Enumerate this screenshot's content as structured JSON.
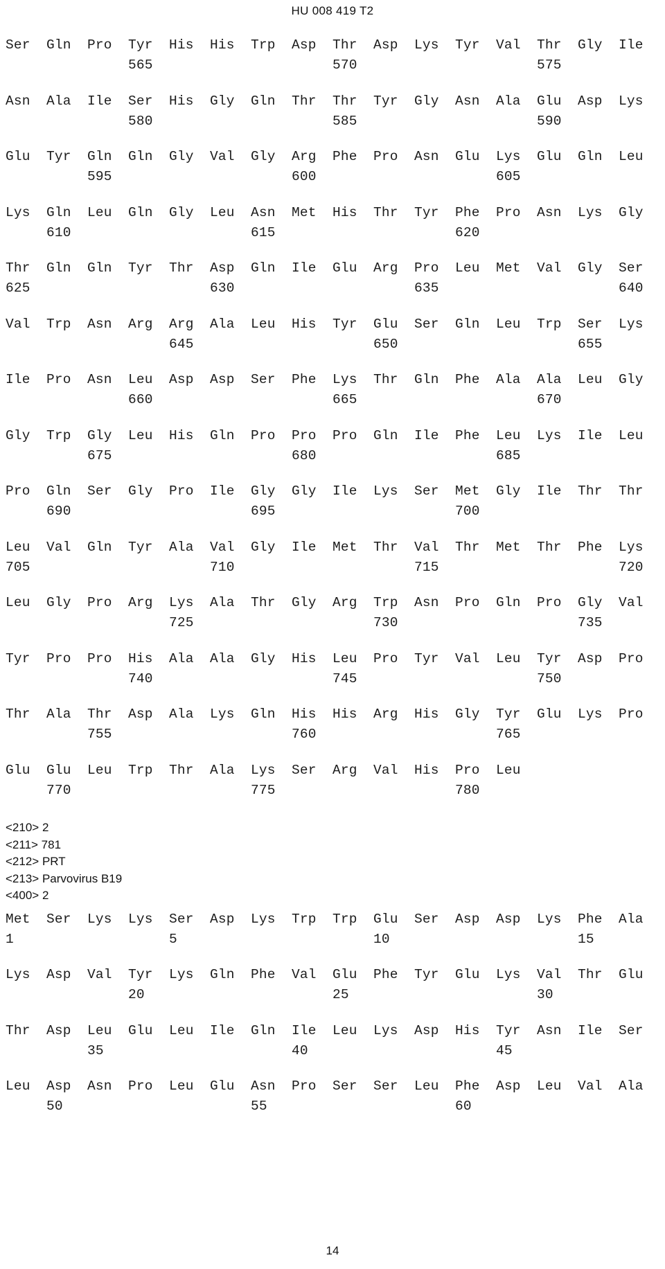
{
  "document": {
    "header": "HU 008 419 T2",
    "page_number": "14"
  },
  "sequence_listing": {
    "blocks": [
      {
        "id": "block-565",
        "residues": [
          "Ser",
          "Gln",
          "Pro",
          "Tyr",
          "His",
          "His",
          "Trp",
          "Asp",
          "Thr",
          "Asp",
          "Lys",
          "Tyr",
          "Val",
          "Thr",
          "Gly",
          "Ile"
        ],
        "numbers": [
          "",
          "",
          "",
          "565",
          "",
          "",
          "",
          "",
          "570",
          "",
          "",
          "",
          "",
          "575",
          "",
          ""
        ]
      },
      {
        "id": "block-580",
        "residues": [
          "Asn",
          "Ala",
          "Ile",
          "Ser",
          "His",
          "Gly",
          "Gln",
          "Thr",
          "Thr",
          "Tyr",
          "Gly",
          "Asn",
          "Ala",
          "Glu",
          "Asp",
          "Lys"
        ],
        "numbers": [
          "",
          "",
          "",
          "580",
          "",
          "",
          "",
          "",
          "585",
          "",
          "",
          "",
          "",
          "590",
          "",
          ""
        ]
      },
      {
        "id": "block-595",
        "residues": [
          "Glu",
          "Tyr",
          "Gln",
          "Gln",
          "Gly",
          "Val",
          "Gly",
          "Arg",
          "Phe",
          "Pro",
          "Asn",
          "Glu",
          "Lys",
          "Glu",
          "Gln",
          "Leu"
        ],
        "numbers": [
          "",
          "",
          "595",
          "",
          "",
          "",
          "",
          "600",
          "",
          "",
          "",
          "",
          "605",
          "",
          "",
          ""
        ]
      },
      {
        "id": "block-610",
        "residues": [
          "Lys",
          "Gln",
          "Leu",
          "Gln",
          "Gly",
          "Leu",
          "Asn",
          "Met",
          "His",
          "Thr",
          "Tyr",
          "Phe",
          "Pro",
          "Asn",
          "Lys",
          "Gly"
        ],
        "numbers": [
          "",
          "610",
          "",
          "",
          "",
          "",
          "615",
          "",
          "",
          "",
          "",
          "620",
          "",
          "",
          "",
          ""
        ]
      },
      {
        "id": "block-625",
        "residues": [
          "Thr",
          "Gln",
          "Gln",
          "Tyr",
          "Thr",
          "Asp",
          "Gln",
          "Ile",
          "Glu",
          "Arg",
          "Pro",
          "Leu",
          "Met",
          "Val",
          "Gly",
          "Ser"
        ],
        "numbers": [
          "625",
          "",
          "",
          "",
          "",
          "630",
          "",
          "",
          "",
          "",
          "635",
          "",
          "",
          "",
          "",
          "640"
        ]
      },
      {
        "id": "block-645",
        "residues": [
          "Val",
          "Trp",
          "Asn",
          "Arg",
          "Arg",
          "Ala",
          "Leu",
          "His",
          "Tyr",
          "Glu",
          "Ser",
          "Gln",
          "Leu",
          "Trp",
          "Ser",
          "Lys"
        ],
        "numbers": [
          "",
          "",
          "",
          "",
          "645",
          "",
          "",
          "",
          "",
          "650",
          "",
          "",
          "",
          "",
          "655",
          ""
        ]
      },
      {
        "id": "block-660",
        "residues": [
          "Ile",
          "Pro",
          "Asn",
          "Leu",
          "Asp",
          "Asp",
          "Ser",
          "Phe",
          "Lys",
          "Thr",
          "Gln",
          "Phe",
          "Ala",
          "Ala",
          "Leu",
          "Gly"
        ],
        "numbers": [
          "",
          "",
          "",
          "660",
          "",
          "",
          "",
          "",
          "665",
          "",
          "",
          "",
          "",
          "670",
          "",
          ""
        ]
      },
      {
        "id": "block-675",
        "residues": [
          "Gly",
          "Trp",
          "Gly",
          "Leu",
          "His",
          "Gln",
          "Pro",
          "Pro",
          "Pro",
          "Gln",
          "Ile",
          "Phe",
          "Leu",
          "Lys",
          "Ile",
          "Leu"
        ],
        "numbers": [
          "",
          "",
          "675",
          "",
          "",
          "",
          "",
          "680",
          "",
          "",
          "",
          "",
          "685",
          "",
          "",
          ""
        ]
      },
      {
        "id": "block-690",
        "residues": [
          "Pro",
          "Gln",
          "Ser",
          "Gly",
          "Pro",
          "Ile",
          "Gly",
          "Gly",
          "Ile",
          "Lys",
          "Ser",
          "Met",
          "Gly",
          "Ile",
          "Thr",
          "Thr"
        ],
        "numbers": [
          "",
          "690",
          "",
          "",
          "",
          "",
          "695",
          "",
          "",
          "",
          "",
          "700",
          "",
          "",
          "",
          ""
        ]
      },
      {
        "id": "block-705",
        "residues": [
          "Leu",
          "Val",
          "Gln",
          "Tyr",
          "Ala",
          "Val",
          "Gly",
          "Ile",
          "Met",
          "Thr",
          "Val",
          "Thr",
          "Met",
          "Thr",
          "Phe",
          "Lys"
        ],
        "numbers": [
          "705",
          "",
          "",
          "",
          "",
          "710",
          "",
          "",
          "",
          "",
          "715",
          "",
          "",
          "",
          "",
          "720"
        ]
      },
      {
        "id": "block-725",
        "residues": [
          "Leu",
          "Gly",
          "Pro",
          "Arg",
          "Lys",
          "Ala",
          "Thr",
          "Gly",
          "Arg",
          "Trp",
          "Asn",
          "Pro",
          "Gln",
          "Pro",
          "Gly",
          "Val"
        ],
        "numbers": [
          "",
          "",
          "",
          "",
          "725",
          "",
          "",
          "",
          "",
          "730",
          "",
          "",
          "",
          "",
          "735",
          ""
        ]
      },
      {
        "id": "block-740",
        "residues": [
          "Tyr",
          "Pro",
          "Pro",
          "His",
          "Ala",
          "Ala",
          "Gly",
          "His",
          "Leu",
          "Pro",
          "Tyr",
          "Val",
          "Leu",
          "Tyr",
          "Asp",
          "Pro"
        ],
        "numbers": [
          "",
          "",
          "",
          "740",
          "",
          "",
          "",
          "",
          "745",
          "",
          "",
          "",
          "",
          "750",
          "",
          ""
        ]
      },
      {
        "id": "block-755",
        "residues": [
          "Thr",
          "Ala",
          "Thr",
          "Asp",
          "Ala",
          "Lys",
          "Gln",
          "His",
          "His",
          "Arg",
          "His",
          "Gly",
          "Tyr",
          "Glu",
          "Lys",
          "Pro"
        ],
        "numbers": [
          "",
          "",
          "755",
          "",
          "",
          "",
          "",
          "760",
          "",
          "",
          "",
          "",
          "765",
          "",
          "",
          ""
        ]
      },
      {
        "id": "block-770",
        "residues": [
          "Glu",
          "Glu",
          "Leu",
          "Trp",
          "Thr",
          "Ala",
          "Lys",
          "Ser",
          "Arg",
          "Val",
          "His",
          "Pro",
          "Leu"
        ],
        "numbers": [
          "",
          "770",
          "",
          "",
          "",
          "",
          "775",
          "",
          "",
          "",
          "",
          "780",
          ""
        ]
      }
    ]
  },
  "sequence_metadata": {
    "lines": [
      "<210> 2",
      "<211> 781",
      "<212> PRT",
      "<213> Parvovirus B19",
      "<400> 2"
    ]
  },
  "sequence_listing_2": {
    "blocks": [
      {
        "id": "block-1",
        "residues": [
          "Met",
          "Ser",
          "Lys",
          "Lys",
          "Ser",
          "Asp",
          "Lys",
          "Trp",
          "Trp",
          "Glu",
          "Ser",
          "Asp",
          "Asp",
          "Lys",
          "Phe",
          "Ala"
        ],
        "numbers": [
          "1",
          "",
          "",
          "",
          "5",
          "",
          "",
          "",
          "",
          "10",
          "",
          "",
          "",
          "",
          "15",
          ""
        ]
      },
      {
        "id": "block-20",
        "residues": [
          "Lys",
          "Asp",
          "Val",
          "Tyr",
          "Lys",
          "Gln",
          "Phe",
          "Val",
          "Glu",
          "Phe",
          "Tyr",
          "Glu",
          "Lys",
          "Val",
          "Thr",
          "Glu"
        ],
        "numbers": [
          "",
          "",
          "",
          "20",
          "",
          "",
          "",
          "",
          "25",
          "",
          "",
          "",
          "",
          "30",
          "",
          ""
        ]
      },
      {
        "id": "block-35",
        "residues": [
          "Thr",
          "Asp",
          "Leu",
          "Glu",
          "Leu",
          "Ile",
          "Gln",
          "Ile",
          "Leu",
          "Lys",
          "Asp",
          "His",
          "Tyr",
          "Asn",
          "Ile",
          "Ser"
        ],
        "numbers": [
          "",
          "",
          "35",
          "",
          "",
          "",
          "",
          "40",
          "",
          "",
          "",
          "",
          "45",
          "",
          "",
          ""
        ]
      },
      {
        "id": "block-50",
        "residues": [
          "Leu",
          "Asp",
          "Asn",
          "Pro",
          "Leu",
          "Glu",
          "Asn",
          "Pro",
          "Ser",
          "Ser",
          "Leu",
          "Phe",
          "Asp",
          "Leu",
          "Val",
          "Ala"
        ],
        "numbers": [
          "",
          "50",
          "",
          "",
          "",
          "",
          "55",
          "",
          "",
          "",
          "",
          "60",
          "",
          "",
          "",
          ""
        ]
      }
    ]
  }
}
